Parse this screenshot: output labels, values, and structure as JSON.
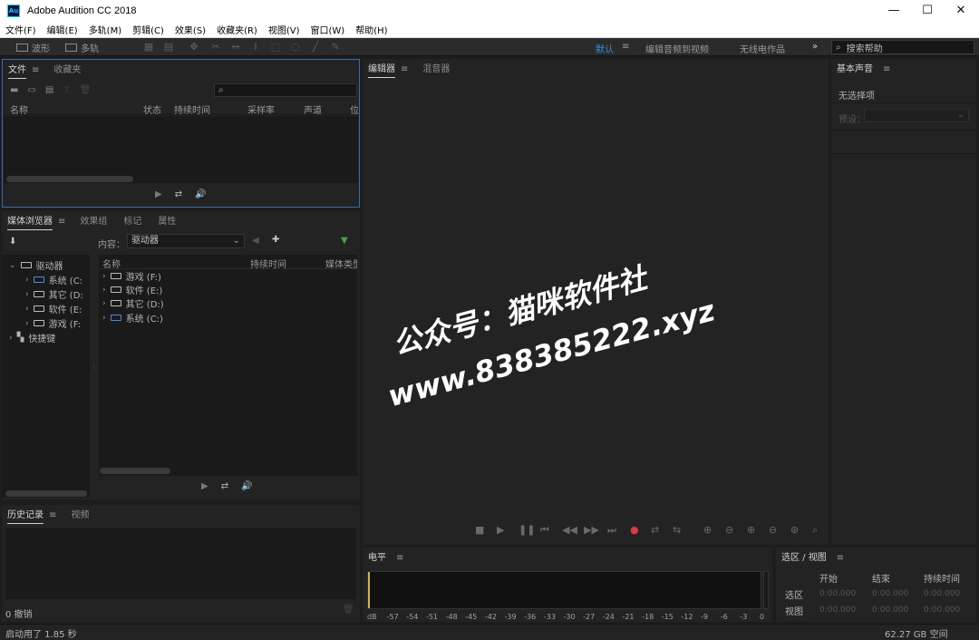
{
  "window": {
    "title": "Adobe Audition CC 2018",
    "app_icon_text": "Au",
    "minimize": "—",
    "maximize": "☐",
    "close": "✕"
  },
  "menu": [
    "文件(F)",
    "编辑(E)",
    "多轨(M)",
    "剪辑(C)",
    "效果(S)",
    "收藏夹(R)",
    "视图(V)",
    "窗口(W)",
    "帮助(H)"
  ],
  "toolbar": {
    "waveform": "波形",
    "multitrack": "多轨"
  },
  "workspaces": {
    "default": "默认",
    "edit_video": "编辑音频到视频",
    "radio": "无线电作品",
    "more": "»"
  },
  "search_help": {
    "placeholder": "搜索帮助"
  },
  "files_panel": {
    "tab_files": "文件",
    "tab_favorites": "收藏夹",
    "columns": [
      "名称",
      "状态",
      "持续时间",
      "采样率",
      "声道",
      "位"
    ]
  },
  "media_panel": {
    "tab_media": "媒体浏览器",
    "tab_effects": "效果组",
    "tab_markers": "标记",
    "tab_props": "属性",
    "content_label": "内容：",
    "content_value": "驱动器",
    "tree_root": "驱动器",
    "tree_items": [
      "系统 (C:",
      "其它 (D:",
      "软件 (E:",
      "游戏 (F:"
    ],
    "shortcuts": "快捷键",
    "columns": [
      "名称",
      "持续时间",
      "媒体类型"
    ],
    "list_items": [
      "游戏 (F:)",
      "软件 (E:)",
      "其它 (D:)",
      "系统 (C:)"
    ]
  },
  "history_panel": {
    "tab_history": "历史记录",
    "tab_video": "视频",
    "undo_count": "0 撤销"
  },
  "editor_panel": {
    "tab_editor": "编辑器",
    "tab_mixer": "混音器"
  },
  "basic_sound": {
    "tab": "基本声音",
    "no_selection": "无选择项",
    "preset_label": "预设："
  },
  "level_panel": {
    "tab": "电平",
    "scale": [
      "dB",
      "-57",
      "-54",
      "-51",
      "-48",
      "-45",
      "-42",
      "-39",
      "-36",
      "-33",
      "-30",
      "-27",
      "-24",
      "-21",
      "-18",
      "-15",
      "-12",
      "-9",
      "-6",
      "-3",
      "0"
    ]
  },
  "selection_panel": {
    "tab": "选区 / 视图",
    "col_start": "开始",
    "col_end": "结束",
    "col_duration": "持续时间",
    "row_selection": "选区",
    "row_view": "视图",
    "time": "0:00.000"
  },
  "status": {
    "left": "启动用了 1.85 秒",
    "right": "62.27 GB 空间"
  },
  "watermark": {
    "line1": "公众号：猫咪软件社",
    "line2": "www.838385222.xyz"
  },
  "colors": {
    "accent": "#2d8ceb",
    "record": "#e0383e",
    "focus_border": "#2d6fb5"
  }
}
